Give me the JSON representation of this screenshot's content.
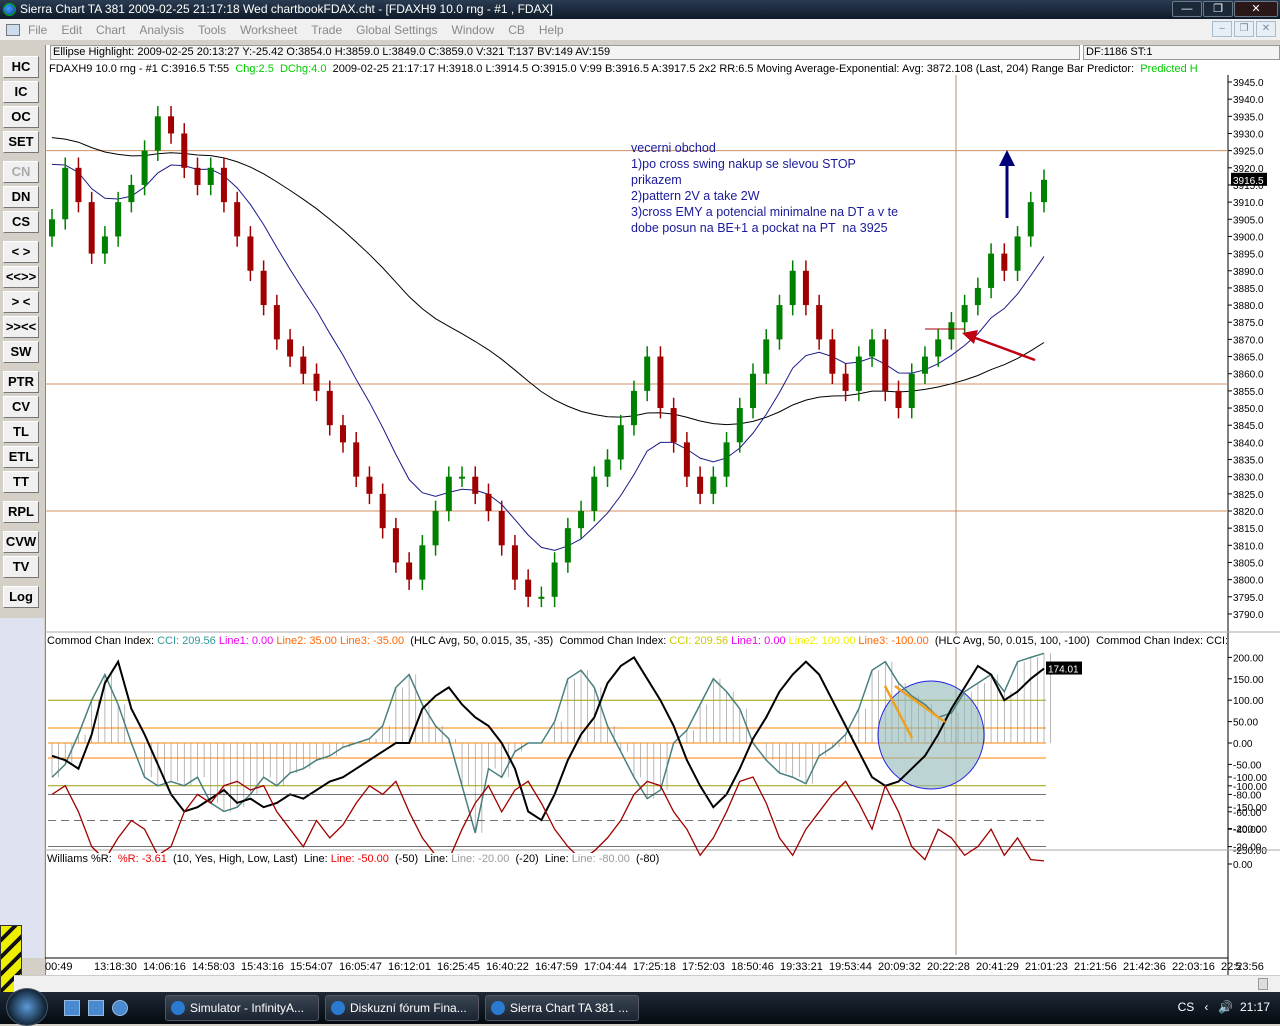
{
  "window": {
    "title": "Sierra Chart TA 381  2009-02-25  21:17:18  Wed   chartbookFDAX.cht - [FDAXH9  10.0 rng - #1 , FDAX]",
    "buttons": [
      "—",
      "❐",
      "✕"
    ],
    "mdi_buttons": [
      "–",
      "❐",
      "✕"
    ]
  },
  "menu": [
    "File",
    "Edit",
    "Chart",
    "Analysis",
    "Tools",
    "Worksheet",
    "Trade",
    "Global Settings",
    "Window",
    "CB",
    "Help"
  ],
  "toolbar": [
    {
      "label": "HC"
    },
    {
      "label": "IC"
    },
    {
      "label": "OC"
    },
    {
      "label": "SET"
    },
    {
      "label": "CN",
      "disabled": true
    },
    {
      "label": "DN"
    },
    {
      "label": "CS"
    },
    {
      "label": "< >"
    },
    {
      "label": "<<>>"
    },
    {
      "label": "> <"
    },
    {
      "label": ">><<"
    },
    {
      "label": "SW"
    },
    {
      "label": "PTR"
    },
    {
      "label": "CV"
    },
    {
      "label": "TL"
    },
    {
      "label": "ETL"
    },
    {
      "label": "TT"
    },
    {
      "label": "RPL"
    },
    {
      "label": "CVW"
    },
    {
      "label": "TV"
    },
    {
      "label": "Log"
    }
  ],
  "infobar": {
    "ellipse": "Ellipse Highlight: 2009-02-25  20:13:27  Y:-25.42  O:3854.0  H:3859.0  L:3849.0  C:3859.0  V:321  T:137  BV:149  AV:159",
    "df": "DF:1186  ST:1"
  },
  "price_header": {
    "main": "FDAXH9  10.0 rng - #1  C:3916.5  T:55",
    "chg": "Chg:2.5",
    "dchg": "DChg:4.0",
    "rest": "2009-02-25  21:17:17  H:3918.0  L:3914.5  O:3915.0  V:99  B:3916.5  A:3917.5  2x2  RR:6.5  Moving Average-Exponential:  Avg: 3872.108   (Last, 204)  Range Bar Predictor:",
    "predicted": "Predicted H"
  },
  "note": "vecerni obchod\n1)po cross swing nakup se slevou STOP\nprikazem\n2)pattern 2V a take 2W\n3)cross EMY a potencial minimalne na DT a v te\ndobe posun na BE+1 a pockat na PT  na 3925",
  "cci_header": {
    "t1": "Commod Chan Index:",
    "cci1": "CCI: 209.56",
    "l1a": "Line1: 0.00",
    "l2a": "Line2: 35.00",
    "l3a": "Line3: -35.00",
    "p1": "(HLC Avg, 50, 0.015, 35, -35)",
    "t2": "Commod Chan Index:",
    "cci2": "CCI: 209.56",
    "l1b": "Line1: 0.00",
    "l2b": "Line2: 100.00",
    "l3b": "Line3: -100.00",
    "p2": "(HLC Avg, 50, 0.015, 100, -100)",
    "t3": "Commod Chan Index:  CCI:"
  },
  "wr_header": {
    "t": "Williams %R:",
    "v": "%R: -3.61",
    "p": "(10, Yes, High, Low, Last)",
    "la": "Line:",
    "l1": "Line: -50.00",
    "l1p": "(-50)",
    "lb": "Line:",
    "l2": "Line: -20.00",
    "l2p": "(-20)",
    "lc": "Line:",
    "l3": "Line: -80.00",
    "l3p": "(-80)"
  },
  "time_axis": [
    "00:49",
    "13:18:30",
    "14:06:16",
    "14:58:03",
    "15:43:16",
    "15:54:07",
    "16:05:47",
    "16:12:01",
    "16:25:45",
    "16:40:22",
    "16:47:59",
    "17:04:44",
    "17:25:18",
    "17:52:03",
    "18:50:46",
    "19:33:21",
    "19:53:44",
    "20:09:32",
    "20:22:28",
    "20:41:29",
    "21:01:23",
    "21:21:56",
    "21:42:36",
    "22:03:16",
    "22:23:56",
    "5"
  ],
  "taskbar": {
    "items": [
      "Simulator - InfinityA...",
      "Diskuzní fórum Fina...",
      "Sierra Chart TA 381  ..."
    ],
    "lang": "CS",
    "clock": "21:17"
  },
  "chart_data": [
    {
      "type": "candlestick",
      "panel": "price",
      "ylim": [
        3785,
        3945
      ],
      "last_price": "3916.5",
      "ema_value": 3872.108,
      "closes": [
        3905,
        3920,
        3910,
        3895,
        3900,
        3910,
        3915,
        3925,
        3935,
        3930,
        3920,
        3915,
        3920,
        3910,
        3900,
        3890,
        3880,
        3870,
        3865,
        3860,
        3855,
        3845,
        3840,
        3830,
        3825,
        3815,
        3805,
        3800,
        3810,
        3820,
        3830,
        3830,
        3825,
        3820,
        3810,
        3800,
        3795,
        3795,
        3805,
        3815,
        3820,
        3830,
        3835,
        3845,
        3855,
        3865,
        3850,
        3840,
        3830,
        3825,
        3830,
        3840,
        3850,
        3860,
        3870,
        3880,
        3890,
        3880,
        3870,
        3860,
        3855,
        3865,
        3870,
        3855,
        3850,
        3860,
        3865,
        3870,
        3875,
        3880,
        3885,
        3895,
        3890,
        3900,
        3910,
        3916.5
      ],
      "hlines": [
        3925,
        3857,
        3820
      ],
      "ticks": [
        "3945.0",
        "3940.0",
        "3935.0",
        "3930.0",
        "3925.0",
        "3920.0",
        "3915.0",
        "3910.0",
        "3905.0",
        "3900.0",
        "3895.0",
        "3890.0",
        "3885.0",
        "3880.0",
        "3875.0",
        "3870.0",
        "3865.0",
        "3860.0",
        "3855.0",
        "3850.0",
        "3845.0",
        "3840.0",
        "3835.0",
        "3830.0",
        "3825.0",
        "3820.0",
        "3815.0",
        "3810.0",
        "3805.0",
        "3800.0",
        "3795.0",
        "3790.0"
      ],
      "colors": {
        "up": "#008000",
        "down": "#a00000",
        "ema_fast": "#1a1a8a",
        "ema_slow": "#000000",
        "hline": "#d09060"
      }
    },
    {
      "type": "line",
      "panel": "cci",
      "ylim": [
        -250,
        210
      ],
      "last_value": "174.01",
      "lines": [
        100,
        35,
        0,
        -35,
        -100
      ],
      "cci": [
        -30,
        -40,
        -60,
        20,
        140,
        190,
        80,
        20,
        -50,
        -120,
        -160,
        -150,
        -130,
        -110,
        -140,
        -130,
        -150,
        -140,
        -120,
        -130,
        -110,
        -90,
        -80,
        -60,
        -40,
        -20,
        0,
        0,
        80,
        110,
        130,
        90,
        60,
        40,
        0,
        -60,
        -160,
        -180,
        -120,
        -40,
        20,
        60,
        140,
        180,
        200,
        150,
        100,
        40,
        -40,
        -100,
        -150,
        -120,
        -60,
        10,
        60,
        120,
        160,
        190,
        160,
        100,
        40,
        -20,
        -80,
        -100,
        -90,
        -60,
        -30,
        20,
        80,
        130,
        180,
        160,
        100,
        120,
        150,
        174
      ],
      "cci_fast": [
        -80,
        -50,
        20,
        100,
        160,
        90,
        0,
        -80,
        -100,
        -90,
        -100,
        -80,
        -140,
        -160,
        -150,
        -120,
        -80,
        -100,
        -70,
        -60,
        -40,
        -30,
        -10,
        0,
        10,
        40,
        130,
        160,
        90,
        40,
        10,
        -100,
        -210,
        -60,
        -80,
        -20,
        0,
        0,
        50,
        150,
        170,
        130,
        40,
        -20,
        -80,
        -130,
        -110,
        0,
        30,
        90,
        150,
        120,
        80,
        0,
        -40,
        -70,
        -80,
        -95,
        -30,
        -10,
        20,
        80,
        170,
        190,
        140,
        110,
        90,
        60,
        70,
        120,
        140,
        160,
        120,
        190,
        200,
        209.56
      ],
      "ticks": [
        "200.00",
        "150.00",
        "100.00",
        "50.00",
        "0.00",
        "-50.00",
        "-100.00",
        "-150.00",
        "-200.00",
        "-250.00"
      ],
      "colors": {
        "cci": "#000000",
        "cci_fast": "#4a8080",
        "line_orange": "#ff8000",
        "line_olive": "#a0a000",
        "ellipse": "#8fb8b8"
      }
    },
    {
      "type": "line",
      "panel": "williams_r",
      "ylim": [
        -100,
        0
      ],
      "lines": [
        -20,
        -50,
        -80
      ],
      "values": [
        -80,
        -90,
        -60,
        -20,
        -5,
        -30,
        -50,
        -40,
        -10,
        -20,
        -60,
        -80,
        -70,
        -90,
        -95,
        -85,
        -90,
        -60,
        -40,
        -20,
        -50,
        -30,
        -45,
        -70,
        -90,
        -80,
        -95,
        -60,
        -30,
        -10,
        -5,
        -40,
        -70,
        -90,
        -60,
        -85,
        -95,
        -70,
        -40,
        -20,
        -5,
        -15,
        -30,
        -50,
        -80,
        -95,
        -90,
        -60,
        -40,
        -10,
        -30,
        -60,
        -95,
        -100,
        -70,
        -30,
        -10,
        -40,
        -60,
        -80,
        -95,
        -70,
        -40,
        -90,
        -60,
        -20,
        -5,
        -40,
        -30,
        -10,
        -20,
        -40,
        -10,
        -30,
        -5,
        -3.61
      ],
      "ticks": [
        "0.00",
        "-20.00",
        "-40.00",
        "-60.00",
        "-80.00",
        "-100.00"
      ],
      "colors": {
        "line": "#a00000"
      }
    }
  ]
}
